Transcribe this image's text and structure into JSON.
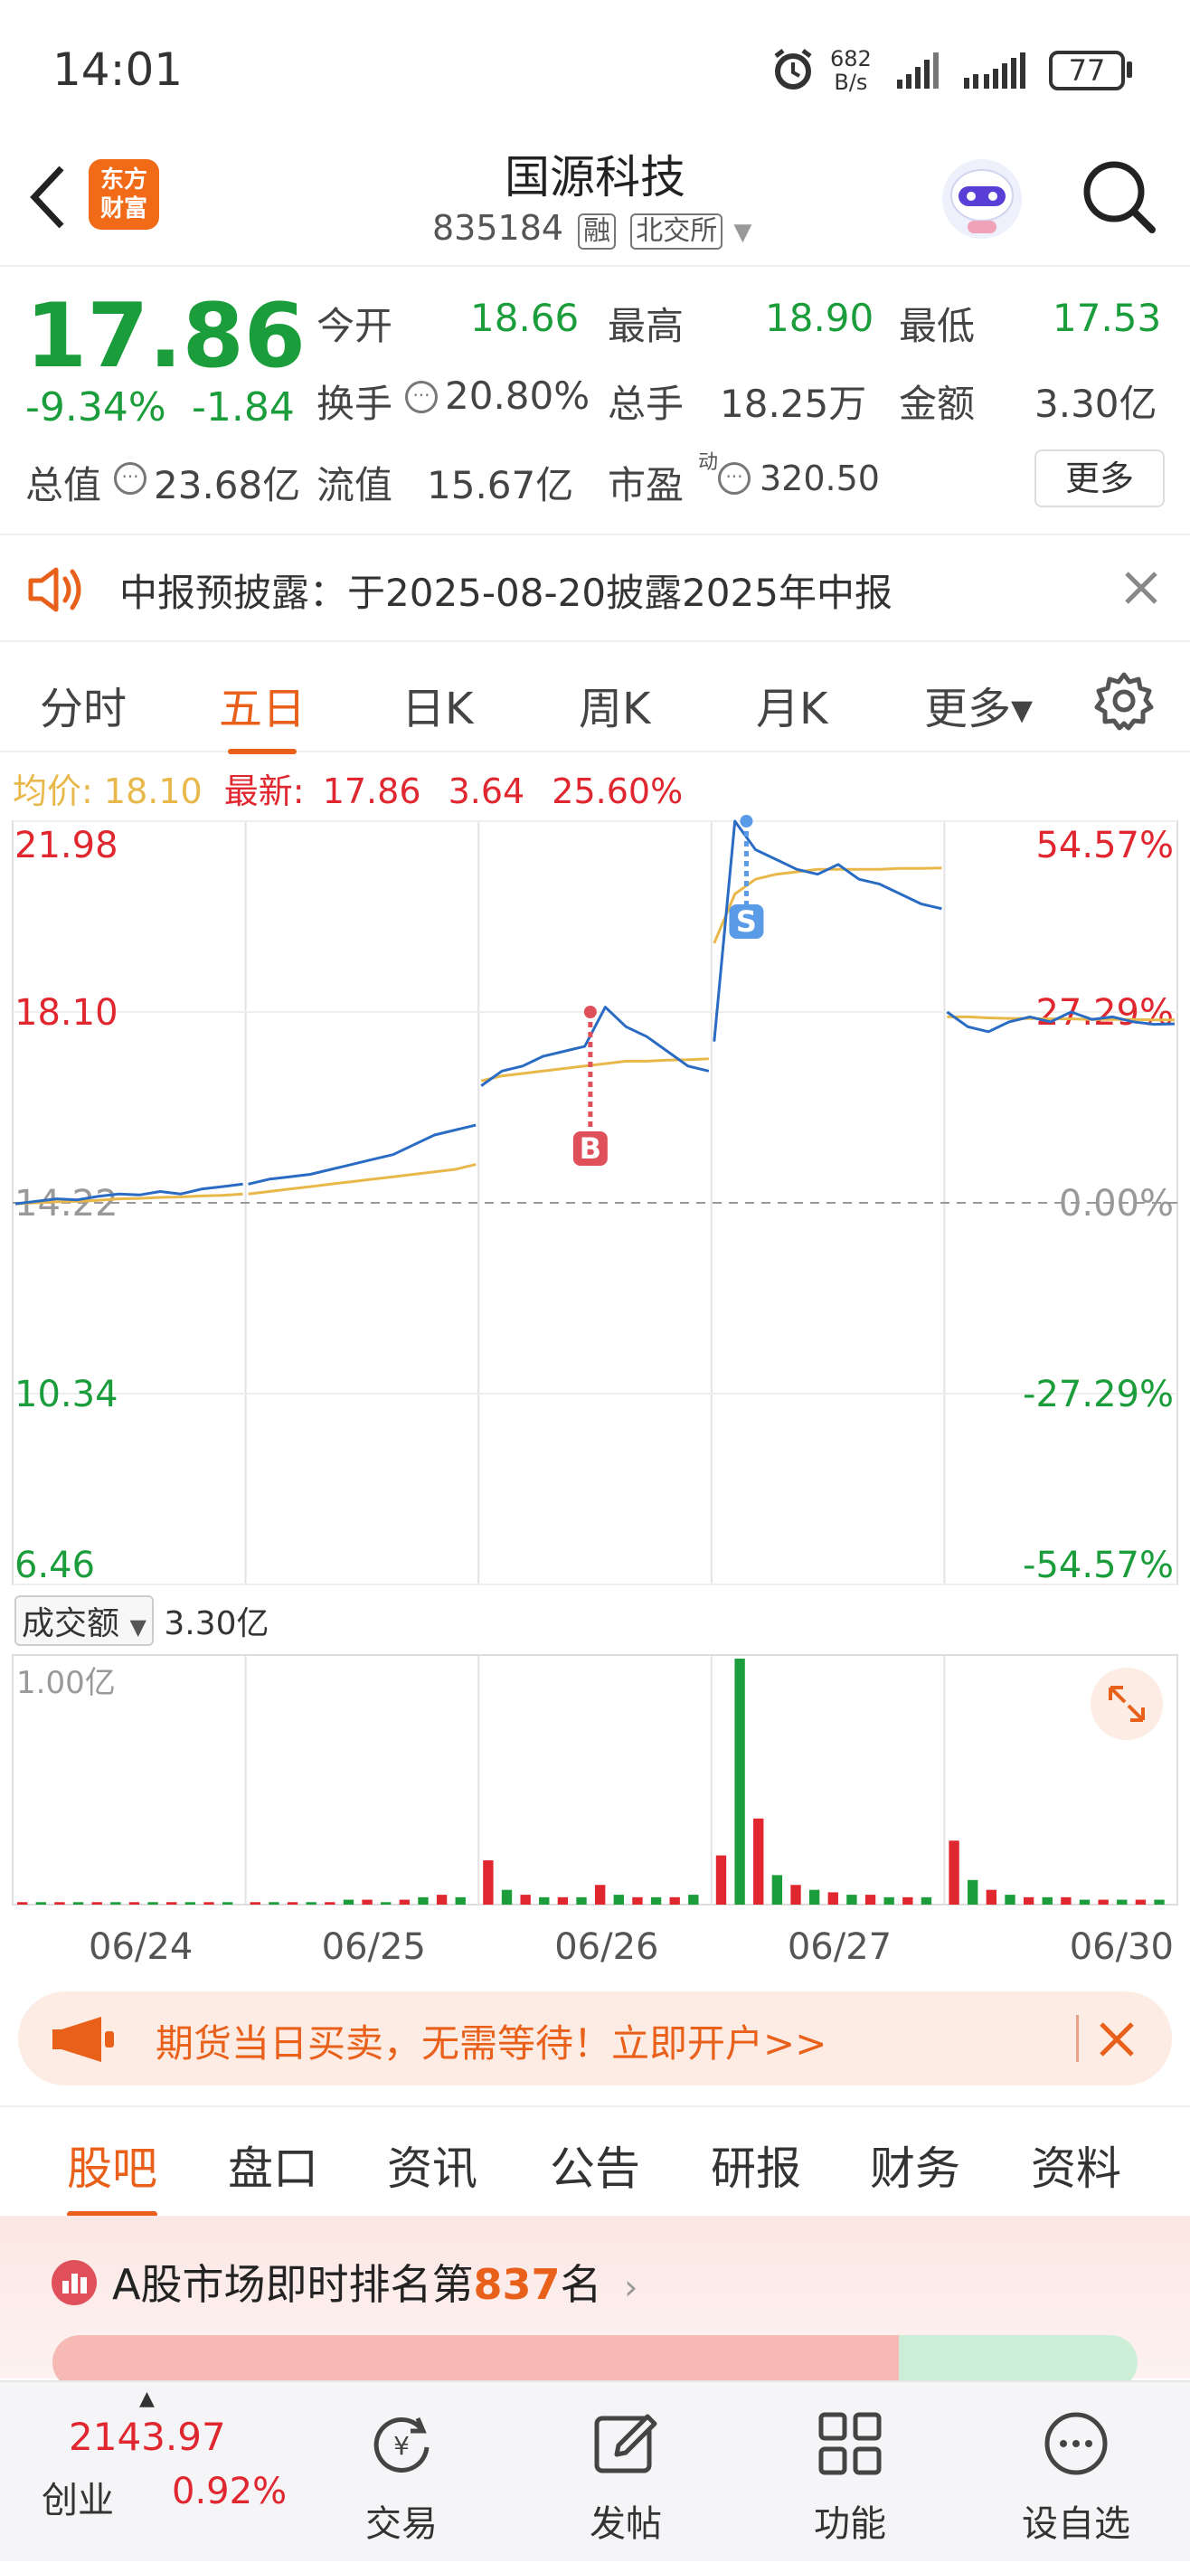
{
  "status_bar": {
    "time": "14:01",
    "net_speed": "682",
    "net_unit": "B/s",
    "battery": "77"
  },
  "header": {
    "logo_text_1": "东方",
    "logo_text_2": "财富",
    "title": "国源科技",
    "code": "835184",
    "tag_margin": "融",
    "tag_exchange": "北交所"
  },
  "quote": {
    "price": "17.86",
    "change_pct": "-9.34%",
    "change": "-1.84",
    "fields": {
      "open_label": "今开",
      "open": "18.66",
      "high_label": "最高",
      "high": "18.90",
      "low_label": "最低",
      "low": "17.53",
      "turnover_label": "换手",
      "turnover": "20.80%",
      "volume_label": "总手",
      "volume": "18.25万",
      "amount_label": "金额",
      "amount": "3.30亿",
      "mktcap_label": "总值",
      "mktcap": "23.68亿",
      "float_label": "流值",
      "float": "15.67亿",
      "pe_label": "市盈",
      "pe_sup": "动",
      "pe": "320.50"
    },
    "more_label": "更多"
  },
  "notice": {
    "text": "中报预披露：于2025-08-20披露2025年中报"
  },
  "period_tabs": [
    {
      "label": "分时"
    },
    {
      "label": "五日"
    },
    {
      "label": "日K"
    },
    {
      "label": "周K"
    },
    {
      "label": "月K"
    },
    {
      "label": "更多▾"
    }
  ],
  "active_period": "五日",
  "legend": {
    "avg_label": "均价:",
    "avg_value": "18.10",
    "last_label": "最新:",
    "last_value": "17.86",
    "chg": "3.64",
    "chg_pct": "25.60%"
  },
  "chart_data": {
    "type": "line",
    "title": "",
    "x_labels": [
      "06/24",
      "06/25",
      "06/26",
      "06/27",
      "06/30"
    ],
    "y_left_labels": [
      "21.98",
      "18.10",
      "14.22",
      "10.34",
      "6.46"
    ],
    "y_right_labels": [
      "54.57%",
      "27.29%",
      "0.00%",
      "-27.29%",
      "-54.57%"
    ],
    "ylim": [
      6.46,
      21.98
    ],
    "prev_close": 14.22,
    "markers": [
      {
        "label": "B",
        "day": 2,
        "price": 18.1
      },
      {
        "label": "S",
        "day": 3,
        "price": 21.98
      }
    ],
    "series": [
      {
        "values": [
          [
            14.2,
            14.25,
            14.3,
            14.28,
            14.35,
            14.4,
            14.38,
            14.45,
            14.4,
            14.5,
            14.55,
            14.6
          ],
          [
            14.6,
            14.7,
            14.75,
            14.8,
            14.9,
            15.0,
            15.1,
            15.2,
            15.4,
            15.6,
            15.7,
            15.8
          ],
          [
            16.6,
            16.9,
            17.0,
            17.2,
            17.3,
            17.4,
            18.2,
            17.8,
            17.6,
            17.3,
            17.0,
            16.9
          ],
          [
            17.5,
            21.98,
            21.4,
            21.2,
            21.0,
            20.9,
            21.1,
            20.8,
            20.7,
            20.5,
            20.3,
            20.2
          ],
          [
            18.1,
            17.8,
            17.7,
            17.9,
            18.0,
            17.9,
            18.1,
            17.95,
            18.0,
            17.9,
            17.85,
            17.86
          ]
        ]
      },
      {
        "values": [
          [
            14.2,
            14.22,
            14.24,
            14.25,
            14.27,
            14.3,
            14.31,
            14.33,
            14.34,
            14.36,
            14.37,
            14.4
          ],
          [
            14.4,
            14.45,
            14.5,
            14.55,
            14.6,
            14.65,
            14.7,
            14.75,
            14.8,
            14.85,
            14.9,
            15.0
          ],
          [
            16.7,
            16.8,
            16.85,
            16.9,
            16.95,
            17.0,
            17.05,
            17.1,
            17.1,
            17.12,
            17.13,
            17.15
          ],
          [
            19.5,
            20.5,
            20.8,
            20.9,
            20.95,
            21.0,
            21.0,
            21.0,
            21.0,
            21.02,
            21.02,
            21.03
          ],
          [
            18.0,
            18.0,
            17.98,
            17.97,
            17.97,
            17.96,
            17.96,
            17.95,
            17.95,
            17.95,
            17.94,
            17.94
          ]
        ]
      }
    ]
  },
  "volume": {
    "label": "成交额",
    "value": "3.30亿",
    "axis_max": "1.00亿",
    "bars": [
      [
        1,
        1,
        1,
        1,
        1,
        1,
        1,
        1,
        1,
        1,
        1,
        1
      ],
      [
        1,
        1,
        1,
        1,
        1,
        2,
        2,
        1,
        2,
        3,
        4,
        3
      ],
      [
        18,
        6,
        4,
        3,
        3,
        3,
        8,
        4,
        3,
        3,
        3,
        4
      ],
      [
        20,
        100,
        35,
        12,
        8,
        6,
        5,
        4,
        4,
        3,
        3,
        3
      ],
      [
        26,
        10,
        6,
        4,
        3,
        3,
        3,
        2,
        2,
        2,
        2,
        2
      ]
    ]
  },
  "ad": {
    "text": "期货当日买卖，无需等待！立即开户>>"
  },
  "info_tabs": [
    {
      "label": "股吧"
    },
    {
      "label": "盘口"
    },
    {
      "label": "资讯"
    },
    {
      "label": "公告"
    },
    {
      "label": "研报"
    },
    {
      "label": "财务"
    },
    {
      "label": "资料"
    }
  ],
  "ranking": {
    "prefix": "A股市场即时排名第",
    "rank": "837",
    "suffix": "名"
  },
  "bottom_nav": {
    "index_value": "2143.97",
    "index_name": "创业",
    "index_pct": "0.92%",
    "items": [
      {
        "label": "交易"
      },
      {
        "label": "发帖"
      },
      {
        "label": "功能"
      },
      {
        "label": "设自选"
      }
    ]
  },
  "colors": {
    "accent": "#e8601a",
    "up": "#e0262f",
    "down": "#1a9d3a",
    "line": "#2a6cc4",
    "avg": "#e8b84a"
  }
}
